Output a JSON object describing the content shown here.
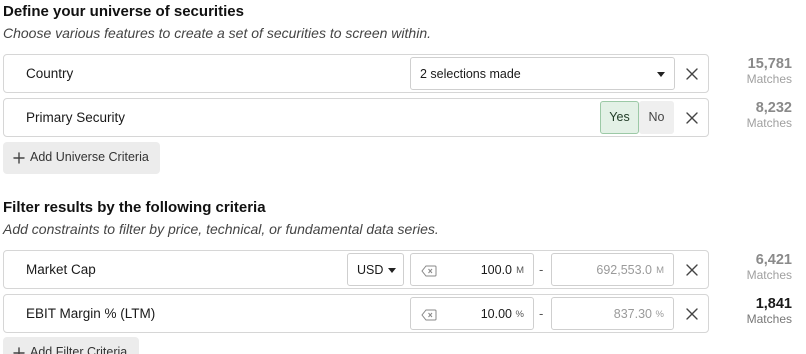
{
  "universe": {
    "title": "Define your universe of securities",
    "subtitle": "Choose various features to create a set of securities to screen within.",
    "criteria": [
      {
        "label": "Country",
        "control": "select",
        "value": "2 selections made",
        "matches_count": "15,781",
        "matches_label": "Matches"
      },
      {
        "label": "Primary Security",
        "control": "toggle",
        "yes_label": "Yes",
        "no_label": "No",
        "selected": "Yes",
        "matches_count": "8,232",
        "matches_label": "Matches"
      }
    ],
    "add_label": "Add Universe Criteria"
  },
  "filters": {
    "title": "Filter results by the following criteria",
    "subtitle": "Add constraints to filter by price, technical, or fundamental data series.",
    "criteria": [
      {
        "label": "Market Cap",
        "currency": "USD",
        "min_value": "100.0",
        "min_unit": "M",
        "range_separator": "-",
        "max_placeholder": "692,553.0",
        "max_unit": "M",
        "matches_count": "6,421",
        "matches_label": "Matches"
      },
      {
        "label": "EBIT Margin % (LTM)",
        "min_value": "10.00",
        "min_unit": "%",
        "range_separator": "-",
        "max_placeholder": "837.30",
        "max_unit": "%",
        "matches_count": "1,841",
        "matches_label": "Matches"
      }
    ],
    "add_label": "Add Filter Criteria"
  },
  "icons": {
    "remove": "close-icon",
    "dropdown": "chevron-down-icon",
    "clear_input": "clear-input-icon",
    "add": "plus-icon"
  },
  "colors": {
    "toggle_selected_bg": "#e3f1e6",
    "toggle_selected_border": "#9cc9a6",
    "border": "#d6d6d6",
    "muted_text": "#8a8a8a"
  }
}
